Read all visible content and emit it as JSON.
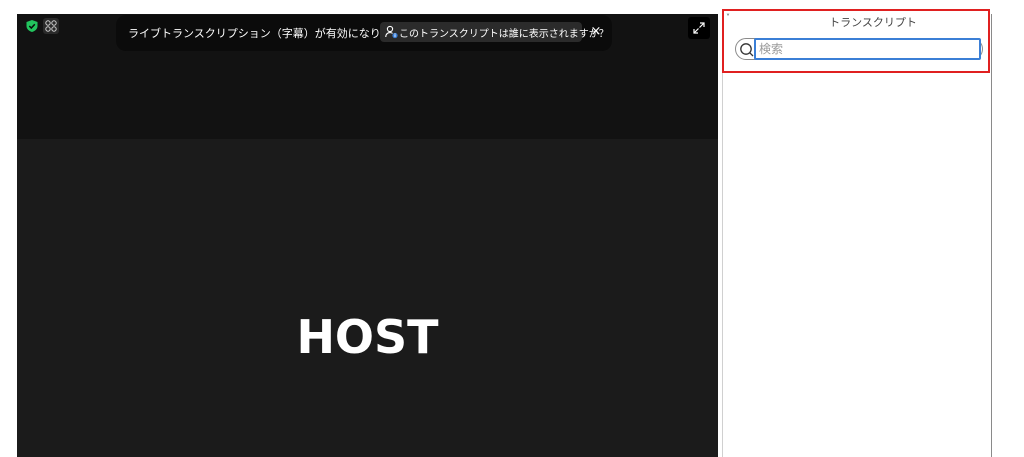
{
  "banner": {
    "message": "ライブトランスクリプション（字幕）が有効になりました",
    "link_label": "このトランスクリプトは誰に表示されますか？",
    "close_label": "×",
    "link_icon": "person-info-icon"
  },
  "video": {
    "participant_name": "HOST",
    "security_icon": "shield-check-icon",
    "view_icon": "grid-icon",
    "expand_icon": "expand-icon"
  },
  "panel": {
    "title": "トランスクリプト",
    "collapse_label": "˅",
    "search": {
      "placeholder": "検索",
      "value": ""
    }
  },
  "colors": {
    "video_bg": "#1b1b1b",
    "accent_blue": "#3b7fd6",
    "highlight_red": "#e02020",
    "shield_green": "#22c55e"
  }
}
